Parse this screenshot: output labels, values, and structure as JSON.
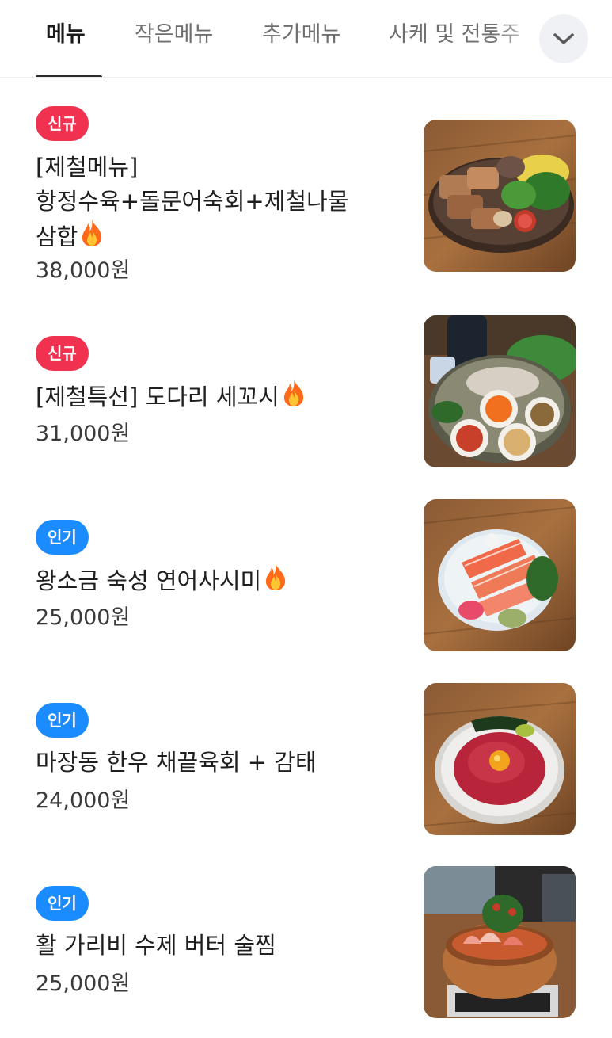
{
  "tabs": [
    {
      "label": "메뉴",
      "active": true
    },
    {
      "label": "작은메뉴",
      "active": false
    },
    {
      "label": "추가메뉴",
      "active": false
    },
    {
      "label": "사케 및 전통주",
      "active": false
    }
  ],
  "more_button_icon": "chevron-down-icon",
  "colors": {
    "badge_new": "#f0314f",
    "badge_popular": "#1a8cff"
  },
  "items": [
    {
      "badge": "신규",
      "name_line1": "[제철메뉴]",
      "name_line2": "항정수육+돌문어숙회+제철나물",
      "name_line3": "삼합",
      "fire_icon": "fire-icon",
      "price": "38,000원",
      "image_icon": "platter-photo"
    },
    {
      "badge": "신규",
      "name": "[제철특선] 도다리 세꼬시",
      "fire_icon": "fire-icon",
      "price": "31,000원",
      "image_icon": "sashimi-platter-photo"
    },
    {
      "badge": "인기",
      "name": "왕소금 숙성 연어사시미",
      "fire_icon": "fire-icon",
      "price": "25,000원",
      "image_icon": "salmon-sashimi-photo"
    },
    {
      "badge": "인기",
      "name": "마장동 한우 채끝육회 + 감태",
      "price": "24,000원",
      "image_icon": "yukhoe-photo"
    },
    {
      "badge": "인기",
      "name": "활 가리비 수제 버터 술찜",
      "price": "25,000원",
      "image_icon": "scallop-hotpot-photo"
    }
  ]
}
